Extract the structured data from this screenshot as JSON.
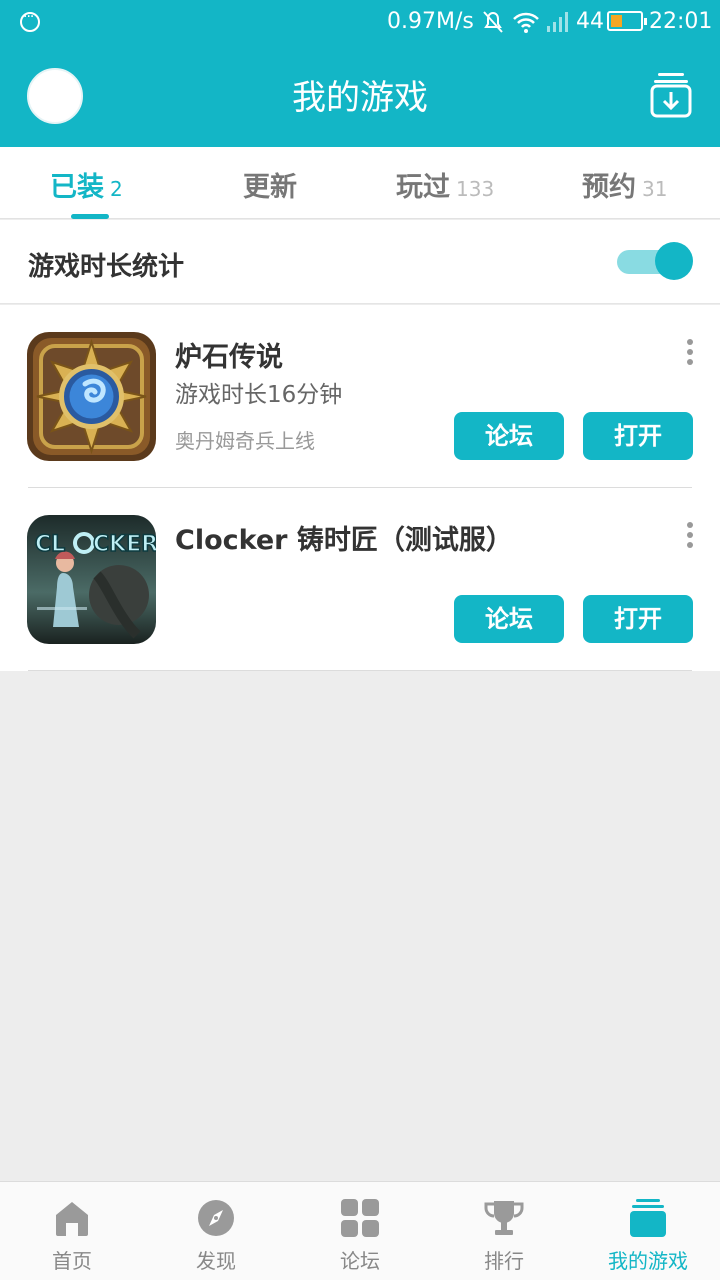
{
  "status_bar": {
    "net_speed": "0.97M/s",
    "battery_level": "44",
    "time": "22:01",
    "icons": [
      "menu-dots-icon",
      "mute-icon",
      "wifi-icon",
      "signal-icon",
      "battery-icon"
    ]
  },
  "header": {
    "title": "我的游戏",
    "download_icon": "download-manager-icon"
  },
  "tabs": [
    {
      "label": "已装",
      "count": "2",
      "active": true
    },
    {
      "label": "更新",
      "count": "",
      "active": false
    },
    {
      "label": "玩过",
      "count": "133",
      "active": false
    },
    {
      "label": "预约",
      "count": "31",
      "active": false
    }
  ],
  "stats": {
    "label": "游戏时长统计",
    "toggle_on": true
  },
  "games": [
    {
      "name": "炉石传说",
      "play_time": "游戏时长16分钟",
      "news": "奥丹姆奇兵上线",
      "forum_label": "论坛",
      "open_label": "打开"
    },
    {
      "name": "Clocker 铸时匠（测试服）",
      "play_time": "",
      "news": "",
      "forum_label": "论坛",
      "open_label": "打开",
      "icon_text": "CLOCKER"
    }
  ],
  "bottom_nav": [
    {
      "label": "首页",
      "icon": "home-icon",
      "active": false
    },
    {
      "label": "发现",
      "icon": "compass-icon",
      "active": false
    },
    {
      "label": "论坛",
      "icon": "grid-icon",
      "active": false
    },
    {
      "label": "排行",
      "icon": "trophy-icon",
      "active": false
    },
    {
      "label": "我的游戏",
      "icon": "my-games-icon",
      "active": true
    }
  ],
  "colors": {
    "accent": "#13b6c6",
    "background": "#ededed"
  }
}
